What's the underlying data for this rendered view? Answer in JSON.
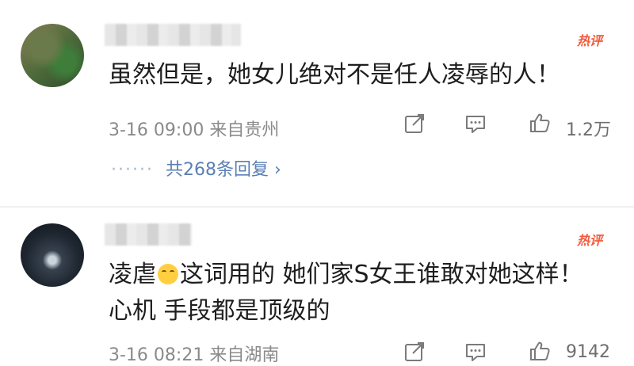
{
  "comments": [
    {
      "username": "",
      "hot_label": "热评",
      "text": "虽然但是，她女儿绝对不是任人凌辱的人！",
      "time": "3-16 09:00",
      "location": "来自贵州",
      "likes": "1.2万",
      "replies": "共268条回复"
    },
    {
      "username": "",
      "hot_label": "热评",
      "text_before_emoji": "凌虐",
      "text_after_emoji": "这词用的  她们家S女王谁敢对她这样！ 心机 手段都是顶级的",
      "time": "3-16 08:21",
      "location": "来自湖南",
      "likes": "9142"
    }
  ],
  "colors": {
    "hot": "#f25a3c",
    "reply_link": "#5a7fb5",
    "meta": "#8a8a8a"
  },
  "icons": [
    "share-icon",
    "comment-icon",
    "thumbs-up-icon",
    "laughing-emoji-icon",
    "chevron-right-icon"
  ]
}
